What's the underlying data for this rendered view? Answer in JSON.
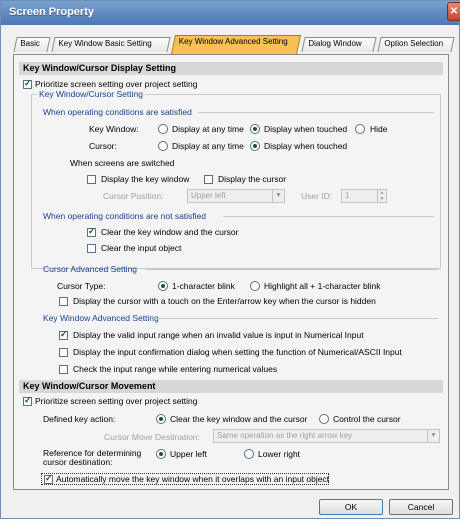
{
  "window": {
    "title": "Screen Property"
  },
  "tabs": [
    {
      "label": "Basic"
    },
    {
      "label": "Key Window Basic Setting"
    },
    {
      "label": "Key Window Advanced Setting"
    },
    {
      "label": "Dialog Window"
    },
    {
      "label": "Option Selection"
    }
  ],
  "display_section": {
    "title": "Key Window/Cursor Display Setting",
    "prioritize_label": "Prioritize screen setting over project setting",
    "kw_group_title": "Key Window/Cursor Setting",
    "satisfied_title": "When operating conditions are satisfied",
    "key_window_label": "Key Window:",
    "cursor_label": "Cursor:",
    "display_any_time": "Display at any time",
    "display_when_touched": "Display when touched",
    "hide": "Hide",
    "screens_switched_title": "When screens are switched",
    "display_key_window": "Display the key window",
    "display_cursor": "Display the cursor",
    "cursor_position_label": "Cursor Position:",
    "cursor_position_value": "Upper left",
    "user_id_label": "User ID:",
    "user_id_value": "1",
    "not_satisfied_title": "When operating conditions are not satisfied",
    "clear_key_window_cursor": "Clear the key window and the cursor",
    "clear_input_object": "Clear the input object",
    "cursor_adv_title": "Cursor Advanced Setting",
    "cursor_type_label": "Cursor Type:",
    "one_char_blink": "1-character blink",
    "highlight_all": "Highlight all + 1-character blink",
    "display_cursor_touch": "Display the cursor with a touch on the Enter/arrow key when the cursor is hidden",
    "kw_adv_title": "Key Window Advanced Setting",
    "display_valid_range": "Display the valid input range when an invalid value is input in Numerical Input",
    "display_confirmation": "Display the input confirmation dialog when setting the function of Numerical/ASCII Input",
    "check_input_range": "Check the input range while entering numerical values"
  },
  "movement_section": {
    "title": "Key Window/Cursor Movement",
    "prioritize_label": "Prioritize screen setting over project setting",
    "defined_key_action_label": "Defined key action:",
    "clear_key_window_cursor": "Clear the key window and the cursor",
    "control_cursor": "Control the cursor",
    "cursor_move_dest_label": "Cursor Move Destination:",
    "cursor_move_dest_value": "Same operation as the right arrow key",
    "reference_label_1": "Reference for determining",
    "reference_label_2": "cursor destination:",
    "upper_left": "Upper left",
    "lower_right": "Lower right",
    "auto_move": "Automatically move the key window when it overlaps with an input object"
  },
  "buttons": {
    "ok": "OK",
    "cancel": "Cancel"
  }
}
